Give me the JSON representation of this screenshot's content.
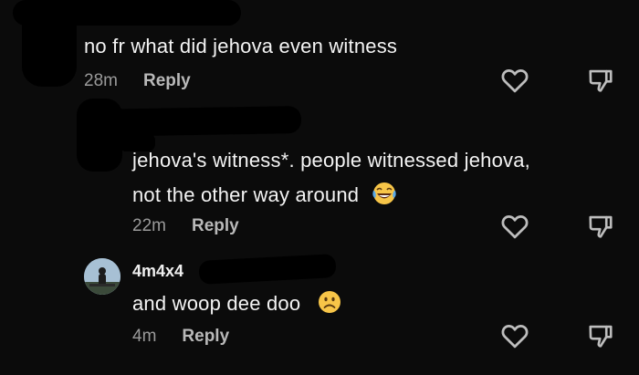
{
  "comments": [
    {
      "text": "no fr what did jehova even witness",
      "time": "28m",
      "reply_label": "Reply"
    },
    {
      "text": "jehova's witness*. people witnessed jehova,",
      "text_line2": "not the other way around",
      "emoji": "tears-of-joy-emoji",
      "time": "22m",
      "reply_label": "Reply"
    },
    {
      "username": "4m4x4",
      "text": "and woop dee doo",
      "emoji": "frowning-face-emoji",
      "time": "4m",
      "reply_label": "Reply"
    }
  ],
  "colors": {
    "background": "#0b0b0b",
    "text": "#f4f4f4",
    "meta": "#9a9a9a",
    "emoji_yellow": "#f7c548"
  },
  "icons": [
    "heart-icon",
    "dislike-icon"
  ]
}
